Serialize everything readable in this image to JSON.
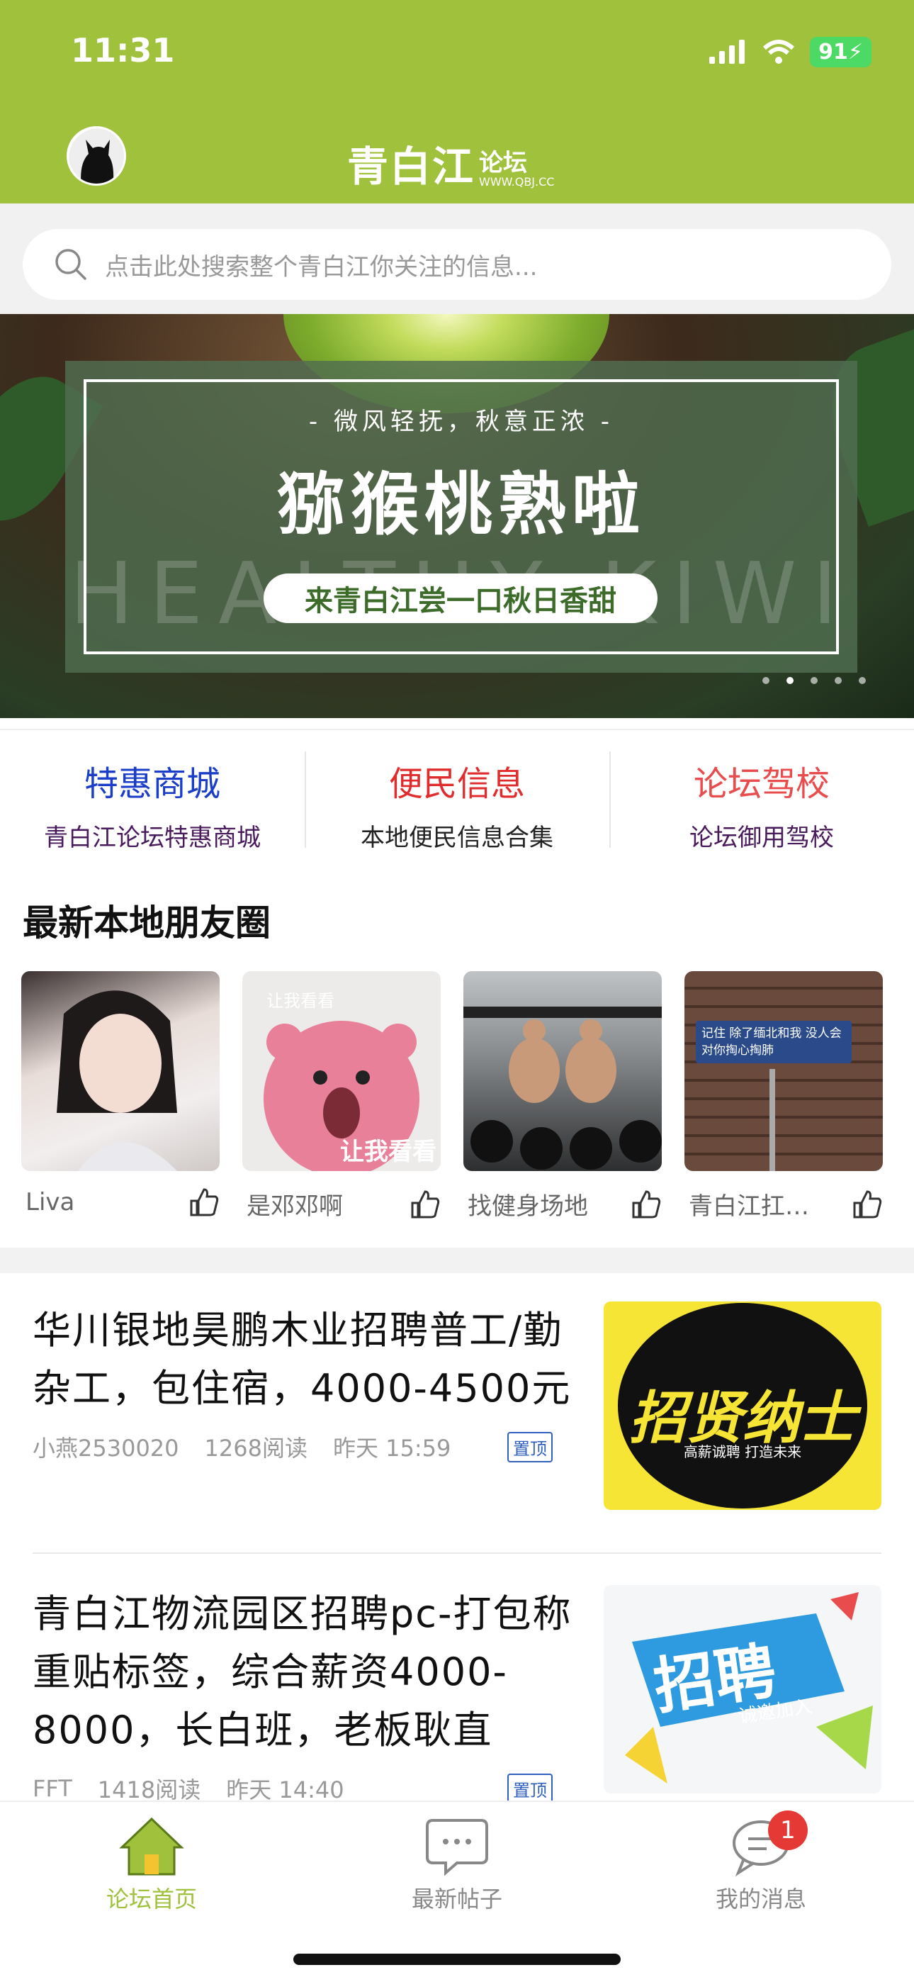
{
  "status_bar": {
    "time": "11:31",
    "battery": "91"
  },
  "header": {
    "logo_main": "青白江",
    "logo_sub": "论坛",
    "logo_url": "WWW.QBJ.CC"
  },
  "search": {
    "placeholder": "点击此处搜索整个青白江你关注的信息..."
  },
  "banner": {
    "subtitle": "- 微风轻抚，秋意正浓 -",
    "title": "猕猴桃熟啦",
    "watermark": "HEALTHY KIWI",
    "pill": "来青白江尝一口秋日香甜",
    "slide_count": 5,
    "active_slide": 1
  },
  "quick_links": [
    {
      "title": "特惠商城",
      "subtitle": "青白江论坛特惠商城",
      "title_color": "#1a3ec9",
      "subtitle_color": "#4a1b5c"
    },
    {
      "title": "便民信息",
      "subtitle": "本地便民信息合集",
      "title_color": "#e02c2c",
      "subtitle_color": "#222222"
    },
    {
      "title": "论坛驾校",
      "subtitle": "论坛御用驾校",
      "title_color": "#e84c4c",
      "subtitle_color": "#4a1b5c"
    }
  ],
  "moments": {
    "title": "最新本地朋友圈",
    "items": [
      {
        "name": "Liva"
      },
      {
        "name": "是邓邓啊",
        "overlay_top": "让我看看",
        "overlay_bottom": "让我看看"
      },
      {
        "name": "找健身场地"
      },
      {
        "name": "青白江扛…",
        "sign_text": "记住 除了缅北和我 没人会对你掏心掏肺"
      }
    ]
  },
  "posts": [
    {
      "title": "华川银地昊鹏木业招聘普工/勤杂工，包住宿，4000-4500元",
      "author": "小燕2530020",
      "reads": "1268阅读",
      "time": "昨天 15:59",
      "pin": "置顶",
      "thumb_text": "招贤纳士",
      "thumb_sub": "高薪诚聘  打造未来"
    },
    {
      "title": "青白江物流园区招聘pc-打包称重贴标签，综合薪资4000-8000，长白班，老板耿直",
      "author": "FFT",
      "reads": "1418阅读",
      "time": "昨天 14:40",
      "pin": "置顶",
      "thumb_text": "招聘",
      "thumb_sub": "诚邀加入"
    }
  ],
  "tabbar": {
    "items": [
      {
        "label": "论坛首页",
        "icon": "home-icon",
        "active": true
      },
      {
        "label": "最新帖子",
        "icon": "chat-bubble-icon",
        "active": false
      },
      {
        "label": "我的消息",
        "icon": "message-icon",
        "active": false,
        "badge": "1"
      }
    ],
    "active_color": "#a0c13c",
    "inactive_color": "#888888"
  },
  "colors": {
    "brand": "#a0c13c",
    "pin": "#2f5fbf"
  }
}
